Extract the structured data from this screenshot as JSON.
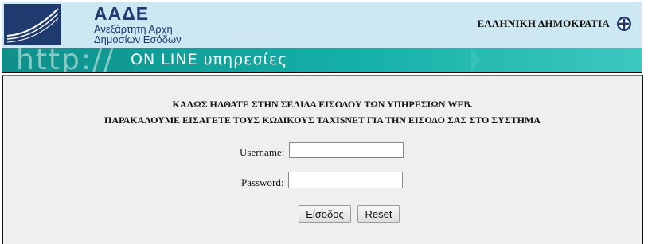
{
  "header": {
    "brand_title": "ΑΑΔΕ",
    "brand_subtitle_line1": "Ανεξάρτητη Αρχή",
    "brand_subtitle_line2": "Δημοσίων Εσόδων",
    "republic_label": "ΕΛΛΗΝΙΚΗ ΔΗΜΟΚΡΑΤΙΑ",
    "logo_icon": "aade-logo-icon",
    "emblem_icon": "greek-emblem-icon"
  },
  "banner": {
    "http_text": "http://",
    "online_text": "ON LINE υπηρεσίες"
  },
  "main": {
    "welcome_line1": "ΚΑΛΩΣ ΗΛΘΑΤΕ ΣΤΗΝ ΣΕΛΙΔΑ ΕΙΣΟΔΟΥ ΤΩΝ ΥΠΗΡΕΣΙΩΝ WEB.",
    "welcome_line2": "ΠΑΡΑΚΑΛΟΥΜΕ ΕΙΣΑΓΕΤΕ ΤΟΥΣ ΚΩΔΙΚΟΥΣ TAXISNET ΓΙΑ ΤΗΝ ΕΙΣΟΔΟ ΣΑΣ ΣΤΟ ΣΥΣΤΗΜΑ"
  },
  "form": {
    "username_label": "Username:",
    "username_value": "",
    "password_label": "Password:",
    "password_value": "",
    "login_button": "Είσοδος",
    "reset_button": "Reset"
  },
  "colors": {
    "brand_navy": "#1e3a6e",
    "header_bg": "#cde8f2",
    "banner_teal": "#14b0a8",
    "panel_bg": "#efefef"
  }
}
